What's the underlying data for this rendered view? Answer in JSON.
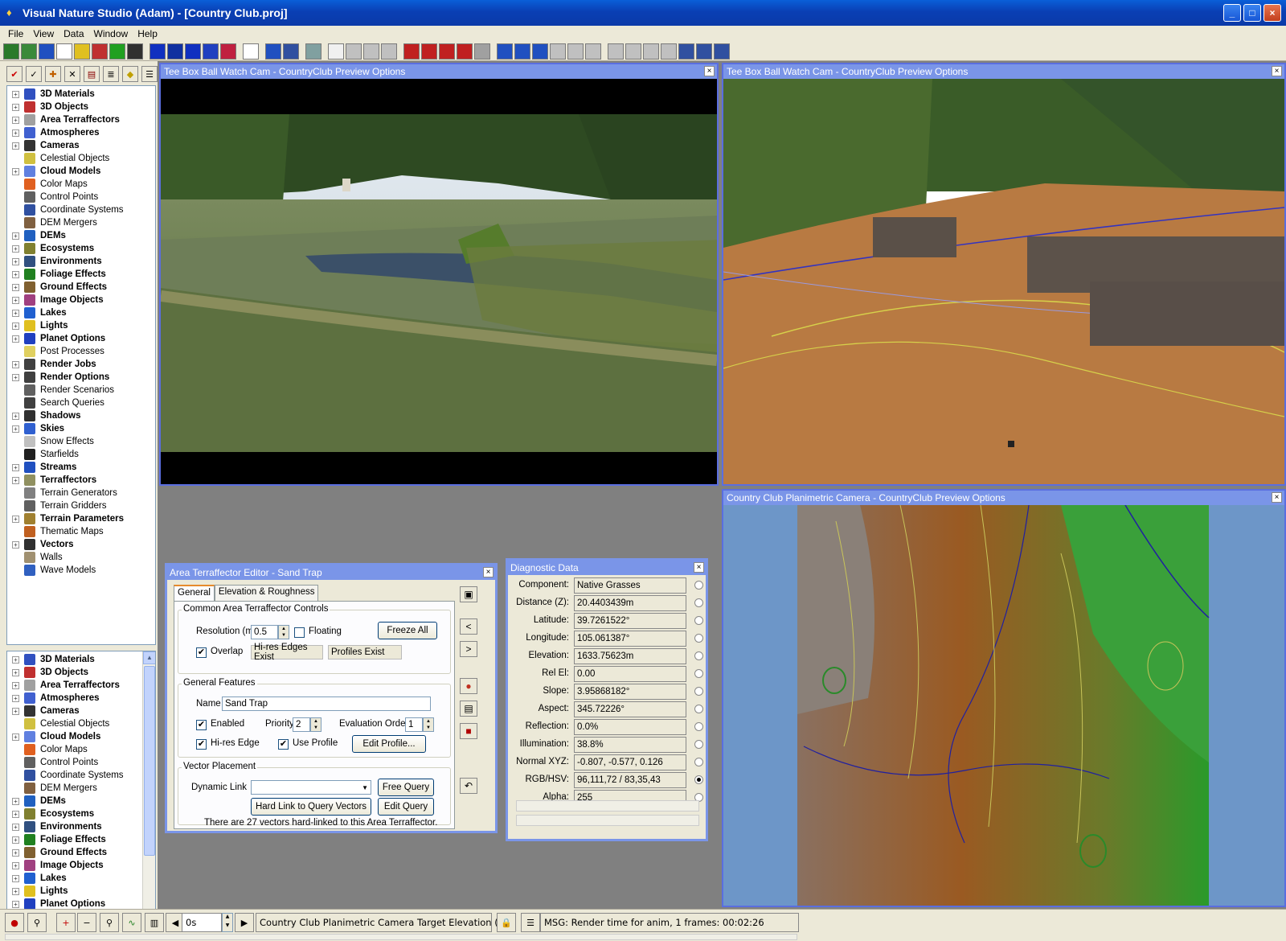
{
  "window": {
    "title": "Visual Nature Studio (Adam) - [Country Club.proj]"
  },
  "menu": [
    "File",
    "View",
    "Data",
    "Window",
    "Help"
  ],
  "tree_items": [
    {
      "label": "3D Materials",
      "bold": true,
      "exp": true,
      "color": "#3050c0"
    },
    {
      "label": "3D Objects",
      "bold": true,
      "exp": true,
      "color": "#c03030"
    },
    {
      "label": "Area Terraffectors",
      "bold": true,
      "exp": true,
      "color": "#a0a0a0"
    },
    {
      "label": "Atmospheres",
      "bold": true,
      "exp": true,
      "color": "#4060d0"
    },
    {
      "label": "Cameras",
      "bold": true,
      "exp": true,
      "color": "#333333"
    },
    {
      "label": "Celestial Objects",
      "bold": false,
      "exp": false,
      "color": "#d0c040"
    },
    {
      "label": "Cloud Models",
      "bold": true,
      "exp": true,
      "color": "#6080e0"
    },
    {
      "label": "Color Maps",
      "bold": false,
      "exp": false,
      "color": "#e06020"
    },
    {
      "label": "Control Points",
      "bold": false,
      "exp": false,
      "color": "#606060"
    },
    {
      "label": "Coordinate Systems",
      "bold": false,
      "exp": false,
      "color": "#3050a0"
    },
    {
      "label": "DEM Mergers",
      "bold": false,
      "exp": false,
      "color": "#806040"
    },
    {
      "label": "DEMs",
      "bold": true,
      "exp": true,
      "color": "#2060c0"
    },
    {
      "label": "Ecosystems",
      "bold": true,
      "exp": true,
      "color": "#808030"
    },
    {
      "label": "Environments",
      "bold": true,
      "exp": true,
      "color": "#305080"
    },
    {
      "label": "Foliage Effects",
      "bold": true,
      "exp": true,
      "color": "#208020"
    },
    {
      "label": "Ground Effects",
      "bold": true,
      "exp": true,
      "color": "#806030"
    },
    {
      "label": "Image Objects",
      "bold": true,
      "exp": true,
      "color": "#a04080"
    },
    {
      "label": "Lakes",
      "bold": true,
      "exp": true,
      "color": "#2060d0"
    },
    {
      "label": "Lights",
      "bold": true,
      "exp": true,
      "color": "#e0c020"
    },
    {
      "label": "Planet Options",
      "bold": true,
      "exp": true,
      "color": "#2040c0"
    },
    {
      "label": "Post Processes",
      "bold": false,
      "exp": false,
      "color": "#e0d060"
    },
    {
      "label": "Render Jobs",
      "bold": true,
      "exp": true,
      "color": "#404040"
    },
    {
      "label": "Render Options",
      "bold": true,
      "exp": true,
      "color": "#404040"
    },
    {
      "label": "Render Scenarios",
      "bold": false,
      "exp": false,
      "color": "#606060"
    },
    {
      "label": "Search Queries",
      "bold": false,
      "exp": false,
      "color": "#404040"
    },
    {
      "label": "Shadows",
      "bold": true,
      "exp": true,
      "color": "#303030"
    },
    {
      "label": "Skies",
      "bold": true,
      "exp": true,
      "color": "#3060d0"
    },
    {
      "label": "Snow Effects",
      "bold": false,
      "exp": false,
      "color": "#c0c0c0"
    },
    {
      "label": "Starfields",
      "bold": false,
      "exp": false,
      "color": "#202020"
    },
    {
      "label": "Streams",
      "bold": true,
      "exp": true,
      "color": "#2050c0"
    },
    {
      "label": "Terraffectors",
      "bold": true,
      "exp": true,
      "color": "#909060"
    },
    {
      "label": "Terrain Generators",
      "bold": false,
      "exp": false,
      "color": "#808080"
    },
    {
      "label": "Terrain Gridders",
      "bold": false,
      "exp": false,
      "color": "#606060"
    },
    {
      "label": "Terrain Parameters",
      "bold": true,
      "exp": true,
      "color": "#a08030"
    },
    {
      "label": "Thematic Maps",
      "bold": false,
      "exp": false,
      "color": "#c06020"
    },
    {
      "label": "Vectors",
      "bold": true,
      "exp": true,
      "color": "#303030"
    },
    {
      "label": "Walls",
      "bold": false,
      "exp": false,
      "color": "#a09070"
    },
    {
      "label": "Wave Models",
      "bold": false,
      "exp": false,
      "color": "#3060c0"
    }
  ],
  "tree2_visible_count": 24,
  "views": {
    "v1": {
      "title": "Tee Box Ball Watch Cam - CountryClub Preview Options"
    },
    "v2": {
      "title": "Tee Box Ball Watch Cam - CountryClub Preview Options"
    },
    "v3": {
      "title": "Country Club Planimetric Camera - CountryClub Preview Options"
    }
  },
  "ate": {
    "title": "Area Terraffector Editor - Sand Trap",
    "tabs": [
      "General",
      "Elevation & Roughness"
    ],
    "common_group": "Common Area Terraffector Controls",
    "resolution_label": "Resolution (m)",
    "resolution_value": "0.5",
    "floating_label": "Floating",
    "freeze_all": "Freeze All",
    "overlap_label": "Overlap",
    "hires_edges_exist": "Hi-res Edges Exist",
    "profiles_exist": "Profiles Exist",
    "general_group": "General Features",
    "name_label": "Name",
    "name_value": "Sand Trap",
    "enabled_label": "Enabled",
    "priority_label": "Priority",
    "priority_value": "2",
    "eval_order_label": "Evaluation Order",
    "eval_order_value": "1",
    "hires_edge_label": "Hi-res Edge",
    "use_profile_label": "Use Profile",
    "edit_profile": "Edit Profile...",
    "vector_group": "Vector Placement",
    "dynamic_link_label": "Dynamic Link",
    "dynamic_link_value": "",
    "free_query": "Free Query",
    "hard_link": "Hard Link to Query Vectors",
    "edit_query": "Edit Query",
    "vector_note": "There are 27 vectors hard-linked to this Area Terraffector."
  },
  "diag": {
    "title": "Diagnostic Data",
    "rows": [
      {
        "label": "Component:",
        "value": "Native Grasses"
      },
      {
        "label": "Distance (Z):",
        "value": "20.4403439m"
      },
      {
        "label": "Latitude:",
        "value": "39.7261522°"
      },
      {
        "label": "Longitude:",
        "value": "105.061387°"
      },
      {
        "label": "Elevation:",
        "value": "1633.75623m"
      },
      {
        "label": "Rel El:",
        "value": "0.00"
      },
      {
        "label": "Slope:",
        "value": "3.95868182°"
      },
      {
        "label": "Aspect:",
        "value": "345.72226°"
      },
      {
        "label": "Reflection:",
        "value": "0.0%"
      },
      {
        "label": "Illumination:",
        "value": "38.8%"
      },
      {
        "label": "Normal XYZ:",
        "value": "-0.807, -0.577, 0.126"
      },
      {
        "label": "RGB/HSV:",
        "value": "96,111,72 / 83,35,43"
      },
      {
        "label": "Alpha:",
        "value": "255"
      }
    ],
    "selected_row": 11
  },
  "status": {
    "time_value": "0s",
    "field_text": "Country Club Planimetric Camera Target Elevation (m)",
    "message": "MSG: Render time for anim, 1 frames:   00:02:26"
  }
}
